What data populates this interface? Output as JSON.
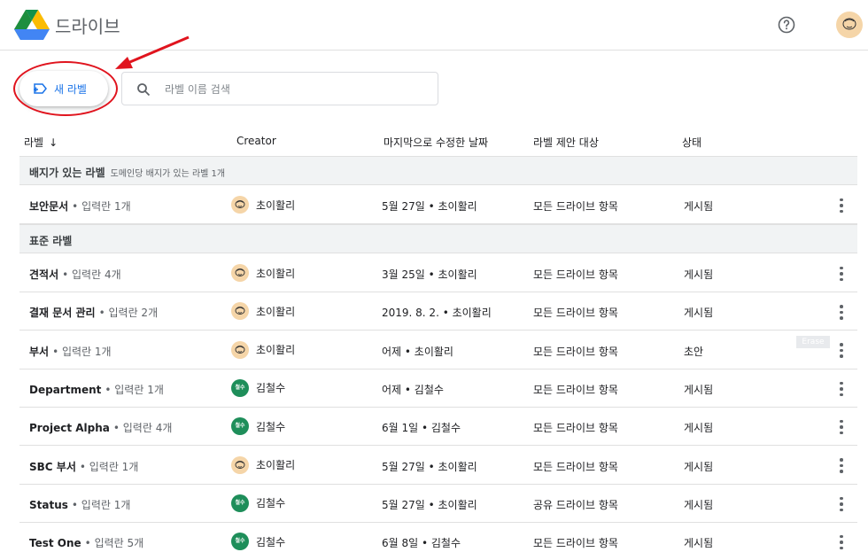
{
  "header": {
    "app_name": "드라이브"
  },
  "toolbar": {
    "new_label": "새 라벨",
    "search_placeholder": "라벨 이름 검색"
  },
  "columns": {
    "label": "라벨",
    "creator": "Creator",
    "modified": "마지막으로 수정한 날짜",
    "scope": "라벨 제안 대상",
    "status": "상태"
  },
  "sections": {
    "badged": {
      "title": "배지가 있는 라벨",
      "subtitle": "도메인당 배지가 있는 라벨 1개"
    },
    "standard": {
      "title": "표준 라벨"
    }
  },
  "badged_rows": [
    {
      "name": "보안문서",
      "fields": "• 입력란 1개",
      "creator": "초이활리",
      "avatar": "face",
      "modified": "5월 27일 • 초이활리",
      "scope": "모든 드라이브 항목",
      "status": "게시됨"
    }
  ],
  "rows": [
    {
      "name": "견적서",
      "fields": "• 입력란 4개",
      "creator": "초이활리",
      "avatar": "face",
      "modified": "3월 25일 • 초이활리",
      "scope": "모든 드라이브 항목",
      "status": "게시됨"
    },
    {
      "name": "결재 문서 관리",
      "fields": "• 입력란 2개",
      "creator": "초이활리",
      "avatar": "face",
      "modified": "2019. 8. 2. • 초이활리",
      "scope": "모든 드라이브 항목",
      "status": "게시됨"
    },
    {
      "name": "부서",
      "fields": "• 입력란 1개",
      "creator": "초이활리",
      "avatar": "face",
      "modified": "어제 • 초이활리",
      "scope": "모든 드라이브 항목",
      "status": "초안",
      "tooltip": "Erase"
    },
    {
      "name": "Department",
      "fields": "• 입력란 1개",
      "creator": "김철수",
      "avatar": "green",
      "modified": "어제 • 김철수",
      "scope": "모든 드라이브 항목",
      "status": "게시됨"
    },
    {
      "name": "Project Alpha",
      "fields": "• 입력란 4개",
      "creator": "김철수",
      "avatar": "green",
      "modified": "6월 1일 • 김철수",
      "scope": "모든 드라이브 항목",
      "status": "게시됨"
    },
    {
      "name": "SBC 부서",
      "fields": "• 입력란 1개",
      "creator": "초이활리",
      "avatar": "face",
      "modified": "5월 27일 • 초이활리",
      "scope": "모든 드라이브 항목",
      "status": "게시됨"
    },
    {
      "name": "Status",
      "fields": "• 입력란 1개",
      "creator": "김철수",
      "avatar": "green",
      "modified": "5월 27일 • 초이활리",
      "scope": "공유 드라이브 항목",
      "status": "게시됨"
    },
    {
      "name": "Test One",
      "fields": "• 입력란 5개",
      "creator": "김철수",
      "avatar": "green",
      "modified": "6월 8일 • 김철수",
      "scope": "모든 드라이브 항목",
      "status": "게시됨"
    }
  ],
  "avatar_initials": "철수",
  "colors": {
    "accent": "#1a73e8",
    "annotation": "#e0141e",
    "avatar_green": "#1e8e5a"
  },
  "icons": [
    "drive-logo-icon",
    "help-icon",
    "new-label-icon",
    "search-icon",
    "sort-down-icon",
    "more-vert-icon"
  ]
}
